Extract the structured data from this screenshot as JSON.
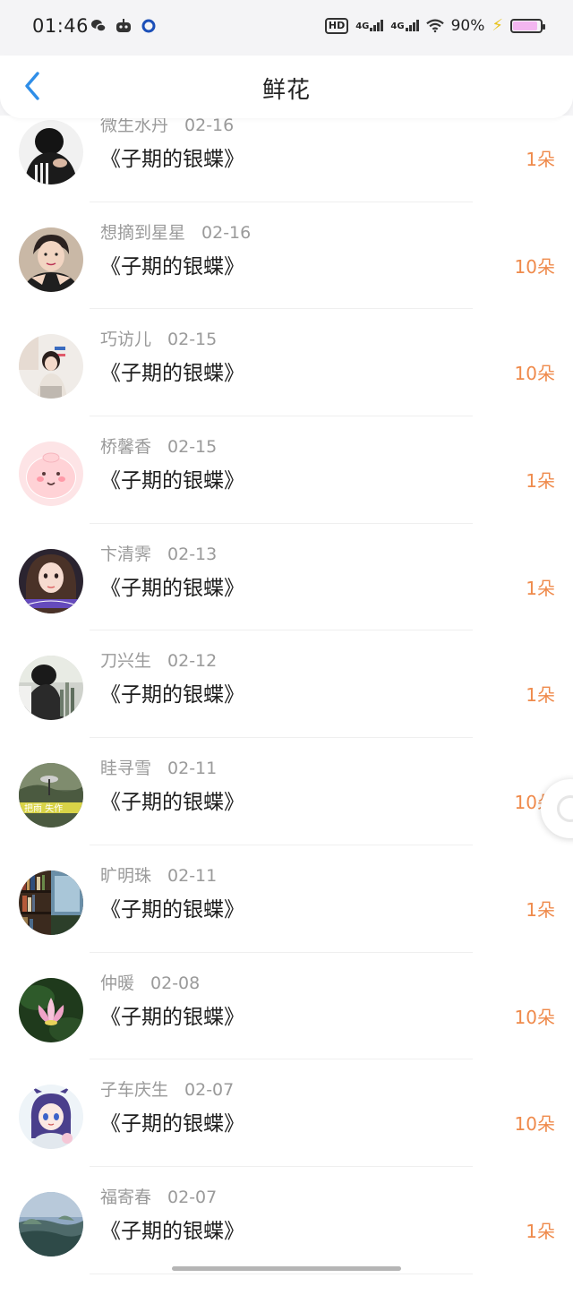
{
  "status_bar": {
    "time": "01:46",
    "left_icons": [
      "wechat-icon",
      "game-controller-icon",
      "app-circle-icon"
    ],
    "hd": "HD",
    "network_1": "4G",
    "network_2": "4G",
    "battery_text": "90%",
    "battery_level": 0.9,
    "battery_color": "#f3b6f0",
    "charging_color": "#e8c21a"
  },
  "nav": {
    "title": "鲜花",
    "back_icon": "chevron-left-icon",
    "accent_color": "#2f8ee8"
  },
  "items": [
    {
      "name": "微生水丹",
      "date": "02-16",
      "book": "《子期的银蝶》",
      "count": "1朵",
      "avatar": "dark-portrait"
    },
    {
      "name": "想摘到星星",
      "date": "02-16",
      "book": "《子期的银蝶》",
      "count": "10朵",
      "avatar": "boy-portrait"
    },
    {
      "name": "巧访儿",
      "date": "02-15",
      "book": "《子期的银蝶》",
      "count": "10朵",
      "avatar": "child-photo"
    },
    {
      "name": "桥馨香",
      "date": "02-15",
      "book": "《子期的银蝶》",
      "count": "1朵",
      "avatar": "pink-cartoon"
    },
    {
      "name": "卞清霁",
      "date": "02-13",
      "book": "《子期的银蝶》",
      "count": "1朵",
      "avatar": "girl-portrait"
    },
    {
      "name": "刀兴生",
      "date": "02-12",
      "book": "《子期的银蝶》",
      "count": "1朵",
      "avatar": "dark-scene"
    },
    {
      "name": "眭寻雪",
      "date": "02-11",
      "book": "《子期的银蝶》",
      "count": "10朵",
      "avatar": "landscape-text"
    },
    {
      "name": "旷明珠",
      "date": "02-11",
      "book": "《子期的银蝶》",
      "count": "1朵",
      "avatar": "bookshelf"
    },
    {
      "name": "仲暖",
      "date": "02-08",
      "book": "《子期的银蝶》",
      "count": "10朵",
      "avatar": "lotus"
    },
    {
      "name": "子车庆生",
      "date": "02-07",
      "book": "《子期的银蝶》",
      "count": "10朵",
      "avatar": "anime-girl"
    },
    {
      "name": "福寄春",
      "date": "02-07",
      "book": "《子期的银蝶》",
      "count": "1朵",
      "avatar": "sea-landscape"
    }
  ],
  "colors": {
    "count": "#ef8a4b",
    "meta": "#9a9a9a"
  },
  "float_button_icon": "floating-circle-icon"
}
